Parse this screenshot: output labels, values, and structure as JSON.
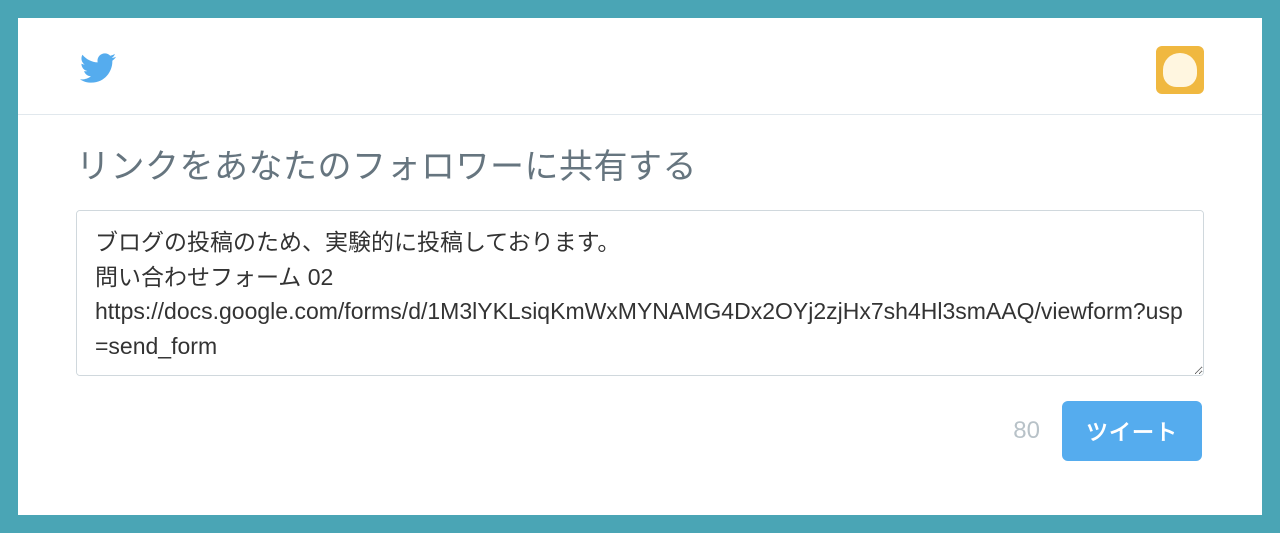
{
  "header": {
    "logo_name": "twitter-bird-icon",
    "avatar_name": "user-avatar"
  },
  "share": {
    "title": "リンクをあなたのフォロワーに共有する",
    "tweet_text": "ブログの投稿のため、実験的に投稿しております。\n問い合わせフォーム 02\nhttps://docs.google.com/forms/d/1M3lYKLsiqKmWxMYNAMG4Dx2OYj2zjHx7sh4Hl3smAAQ/viewform?usp=send_form",
    "char_count": "80",
    "tweet_button_label": "ツイート"
  },
  "colors": {
    "brand": "#55acee",
    "page_bg": "#4aa5b5",
    "muted_text": "#66757f"
  }
}
